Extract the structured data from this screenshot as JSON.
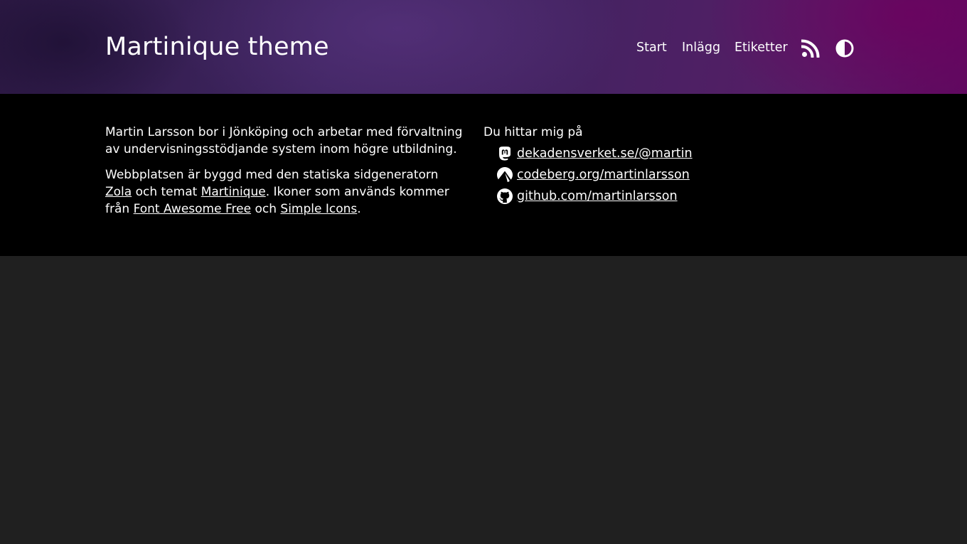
{
  "header": {
    "site_title": "Martinique theme",
    "nav": [
      {
        "label": "Start"
      },
      {
        "label": "Inlägg"
      },
      {
        "label": "Etiketter"
      }
    ],
    "rss_icon": "rss-icon",
    "theme_toggle_icon": "contrast-icon"
  },
  "footer": {
    "about": {
      "line1": "Martin Larsson bor i Jönköping och arbetar med förvaltning av undervisningsstödjande system inom högre utbildning.",
      "p2_before_zola": "Webbplatsen är byggd med den statiska sidgeneratorn ",
      "zola_link": "Zola",
      "p2_middle": " och temat ",
      "martinique_link": "Martinique",
      "p2_after": ". Ikoner som används kommer från ",
      "font_awesome_link": "Font Awesome Free",
      "p2_och": " och ",
      "simple_icons_link": "Simple Icons",
      "p2_end": "."
    },
    "contact": {
      "heading": "Du hittar mig på",
      "links": [
        {
          "icon": "mastodon-icon",
          "label": "dekadensverket.se/@martin"
        },
        {
          "icon": "codeberg-icon",
          "label": "codeberg.org/martinlarsson"
        },
        {
          "icon": "github-icon",
          "label": "github.com/martinlarsson"
        }
      ]
    }
  },
  "colors": {
    "header_gradient_start": "#2e1a46",
    "header_gradient_end": "#5d0a5f",
    "footer_bg": "#000000",
    "page_bg": "#202020",
    "text": "#ffffff"
  }
}
